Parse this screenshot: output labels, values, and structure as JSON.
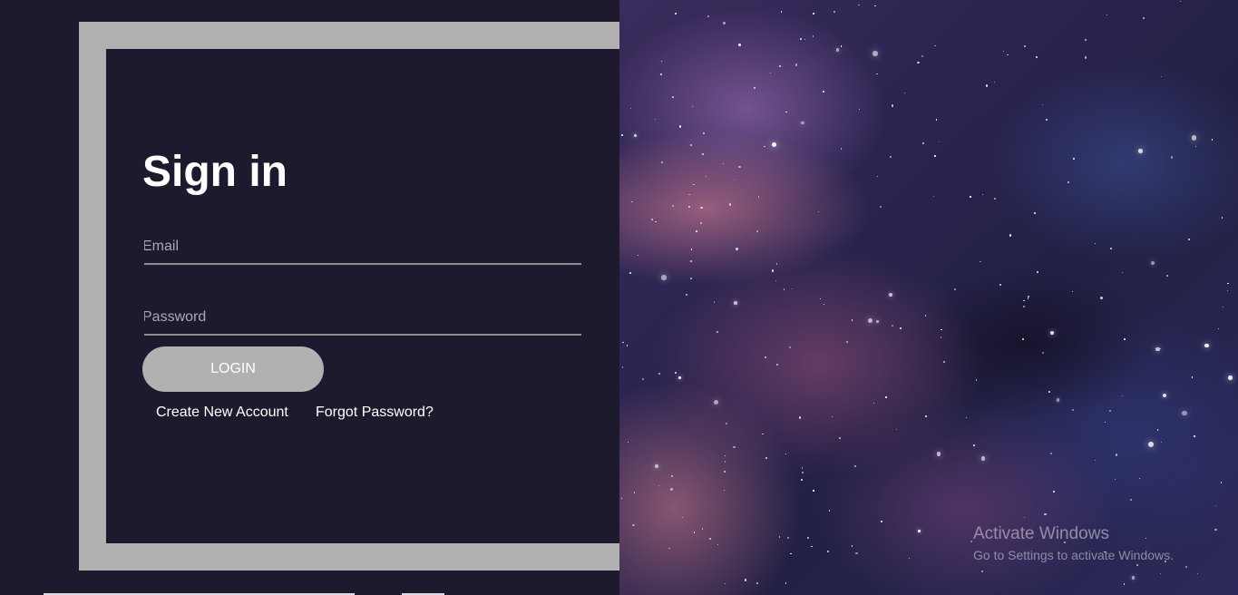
{
  "signin": {
    "title": "Sign in",
    "email_placeholder": "Email",
    "password_placeholder": "Password",
    "login_label": "LOGIN",
    "create_account_label": "Create New Account",
    "forgot_password_label": "Forgot Password?"
  },
  "watermark": {
    "title": "Activate Windows",
    "subtitle": "Go to Settings to activate Windows."
  },
  "colors": {
    "background": "#1e1a2e",
    "frame": "#b1b1b1",
    "button": "#b1b1b1",
    "text": "#ffffff",
    "underline": "#8c8c8c"
  }
}
